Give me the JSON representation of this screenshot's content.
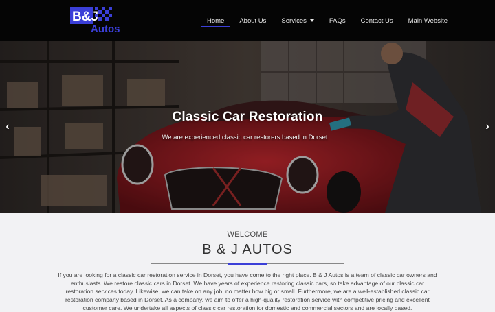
{
  "logo": {
    "text_top": "B&J",
    "text_bottom": "Autos"
  },
  "nav": [
    {
      "label": "Home",
      "active": true
    },
    {
      "label": "About Us"
    },
    {
      "label": "Services",
      "dropdown": true
    },
    {
      "label": "FAQs"
    },
    {
      "label": "Contact Us"
    },
    {
      "label": "Main Website"
    }
  ],
  "hero": {
    "title": "Classic Car Restoration",
    "subtitle": "We are experienced classic car restorers based in Dorset",
    "prev_icon": "chevron-left-icon",
    "next_icon": "chevron-right-icon"
  },
  "intro": {
    "eyebrow": "WELCOME",
    "title": "B & J AUTOS",
    "paragraph": "If you are looking for a classic car restoration service in Dorset, you have come to the right place. B & J Autos is a team of classic car owners and enthusiasts. We restore classic cars in Dorset. We have years of experience restoring classic cars, so take advantage of our classic car restoration services today. Likewise, we can take on any job, no matter how big or small. Furthermore, we are a well-established classic car restoration company based in Dorset. As a company, we aim to offer a high-quality restoration service with competitive pricing and excellent customer care. We undertake all aspects of classic car restoration for domestic and commercial sectors and are locally based."
  },
  "colors": {
    "accent": "#3b3fd8",
    "header_bg": "#050505",
    "page_bg": "#f2f2f4"
  }
}
